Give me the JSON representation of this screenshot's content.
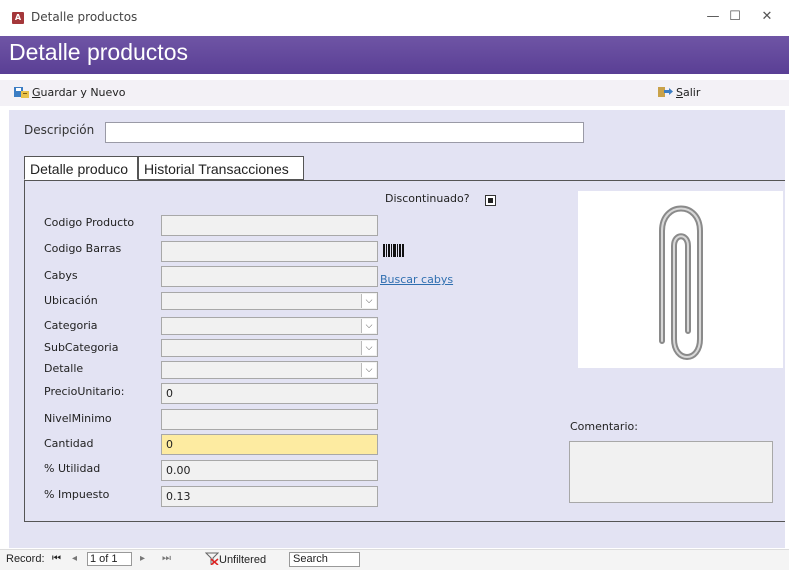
{
  "window": {
    "title": "Detalle productos",
    "app_icon_text": "A",
    "minimize_icon": "minimize-icon",
    "maximize_icon": "maximize-icon",
    "close_icon": "close-icon"
  },
  "header": {
    "title": "Detalle productos",
    "accent_color": "#5f4599"
  },
  "toolbar": {
    "save_new": {
      "accel": "G",
      "rest": "uardar y Nuevo",
      "icon": "save-new-icon"
    },
    "exit": {
      "accel": "S",
      "rest": "alir",
      "icon": "exit-icon"
    }
  },
  "form": {
    "descripcion_label": "Descripción",
    "descripcion_value": "",
    "tabs": [
      {
        "label": "Detalle produco",
        "active": true
      },
      {
        "label": "Historial Transacciones",
        "active": false
      }
    ],
    "discontinuado_label": "Discontinuado?",
    "discontinuado_checked": true,
    "fields": {
      "codigo_producto": {
        "label": "Codigo Producto",
        "value": ""
      },
      "codigo_barras": {
        "label": "Codigo Barras",
        "value": ""
      },
      "cabys": {
        "label": "Cabys",
        "value": ""
      },
      "ubicacion": {
        "label": "Ubicación",
        "value": ""
      },
      "categoria": {
        "label": "Categoria",
        "value": ""
      },
      "subcategoria": {
        "label": "SubCategoria",
        "value": ""
      },
      "detalle": {
        "label": "Detalle",
        "value": ""
      },
      "precio_unitario": {
        "label": "PrecioUnitario:",
        "value": "0"
      },
      "nivel_minimo": {
        "label": "NivelMinimo",
        "value": ""
      },
      "cantidad": {
        "label": "Cantidad",
        "value": "0",
        "highlight_color": "#fdeba1"
      },
      "utilidad": {
        "label": "% Utilidad",
        "value": "0.00"
      },
      "impuesto": {
        "label": "% Impuesto",
        "value": "0.13"
      }
    },
    "buscar_cabys_link": "Buscar cabys",
    "barcode_icon": "barcode-icon",
    "attachment_icon": "paperclip-icon",
    "comentario_label": "Comentario:",
    "comentario_value": ""
  },
  "statusbar": {
    "record_label": "Record:",
    "record_value": "1 of 1",
    "filter_label": "Unfiltered",
    "search_placeholder": "Search",
    "nav_first_icon": "first-record-icon",
    "nav_prev_icon": "prev-record-icon",
    "nav_next_icon": "next-record-icon",
    "nav_last_icon": "last-record-icon",
    "filter_icon": "no-filter-icon"
  }
}
